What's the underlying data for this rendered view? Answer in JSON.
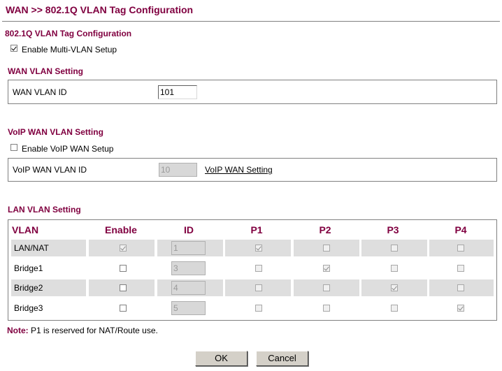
{
  "page": {
    "title": "WAN >> 802.1Q VLAN Tag Configuration"
  },
  "config": {
    "section_title": "802.1Q VLAN Tag Configuration",
    "multi_vlan_label": "Enable Multi-VLAN Setup",
    "multi_vlan_checked": true
  },
  "wan_vlan": {
    "section_title": "WAN VLAN Setting",
    "id_label": "WAN VLAN ID",
    "id_value": "101"
  },
  "voip_vlan": {
    "section_title": "VoIP WAN VLAN Setting",
    "enable_label": "Enable VoIP WAN Setup",
    "enable_checked": false,
    "id_label": "VoIP WAN VLAN ID",
    "id_value": "10",
    "link_label": "VoIP WAN Setting"
  },
  "lan_vlan": {
    "section_title": "LAN VLAN Setting",
    "headers": [
      "VLAN",
      "Enable",
      "ID",
      "P1",
      "P2",
      "P3",
      "P4"
    ],
    "rows": [
      {
        "name": "LAN/NAT",
        "enable": true,
        "id": "1",
        "p1": true,
        "p2": false,
        "p3": false,
        "p4": false
      },
      {
        "name": "Bridge1",
        "enable": false,
        "id": "3",
        "p1": false,
        "p2": true,
        "p3": false,
        "p4": false
      },
      {
        "name": "Bridge2",
        "enable": false,
        "id": "4",
        "p1": false,
        "p2": false,
        "p3": true,
        "p4": false
      },
      {
        "name": "Bridge3",
        "enable": false,
        "id": "5",
        "p1": false,
        "p2": false,
        "p3": false,
        "p4": true
      }
    ]
  },
  "note": {
    "label": "Note:",
    "text": " P1 is reserved for NAT/Route use."
  },
  "buttons": {
    "ok": "OK",
    "cancel": "Cancel"
  },
  "colors": {
    "title": "#800040",
    "row_shade": "#dedede"
  }
}
